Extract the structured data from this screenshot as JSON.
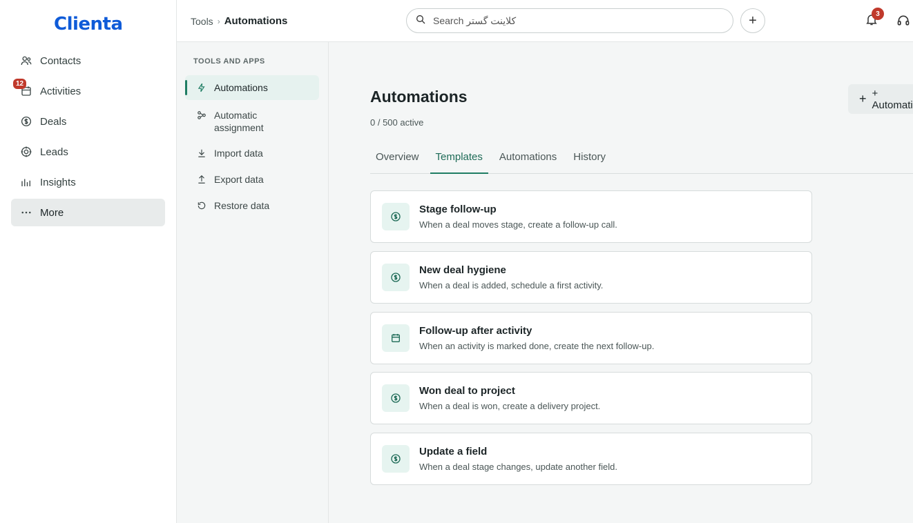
{
  "app": {
    "logo": "Clienta"
  },
  "nav": {
    "items": [
      {
        "label": "Contacts",
        "icon": "contacts-icon"
      },
      {
        "label": "Activities",
        "icon": "calendar-icon",
        "badge": "12"
      },
      {
        "label": "Deals",
        "icon": "deals-icon"
      },
      {
        "label": "Leads",
        "icon": "target-icon"
      },
      {
        "label": "Insights",
        "icon": "chart-icon"
      },
      {
        "label": "More",
        "icon": "more-icon",
        "active": true
      }
    ]
  },
  "header": {
    "breadcrumb": [
      "Tools",
      "Automations"
    ],
    "search_placeholder": "Search کلاینت گستر",
    "notifications_count": "3"
  },
  "subnav": {
    "title": "TOOLS AND APPS",
    "items": [
      {
        "label": "Automations",
        "icon": "bolt-icon",
        "active": true
      },
      {
        "label": "Automatic assignment",
        "icon": "assignment-icon"
      },
      {
        "label": "Import data",
        "icon": "download-icon"
      },
      {
        "label": "Export data",
        "icon": "upload-icon"
      },
      {
        "label": "Restore data",
        "icon": "restore-icon"
      }
    ]
  },
  "main": {
    "title": "Automations",
    "count": "0 / 500 active",
    "add_button": "+ Automation",
    "tabs": [
      {
        "label": "Overview"
      },
      {
        "label": "Templates",
        "active": true
      },
      {
        "label": "Automations"
      },
      {
        "label": "History"
      }
    ],
    "templates": [
      {
        "title": "Stage follow-up",
        "desc": "When a deal moves stage, create a follow-up call.",
        "icon": "deal-icon"
      },
      {
        "title": "New deal hygiene",
        "desc": "When a deal is added, schedule a first activity.",
        "icon": "deal-icon"
      },
      {
        "title": "Follow-up after activity",
        "desc": "When an activity is marked done, create the next follow-up.",
        "icon": "calendar-icon"
      },
      {
        "title": "Won deal to project",
        "desc": "When a deal is won, create a delivery project.",
        "icon": "deal-icon"
      },
      {
        "title": "Update a field",
        "desc": "When a deal stage changes, update another field.",
        "icon": "deal-icon"
      }
    ]
  },
  "colors": {
    "accent": "#1e7d63",
    "brand": "#0f5bd8",
    "badge": "#c0392b"
  }
}
